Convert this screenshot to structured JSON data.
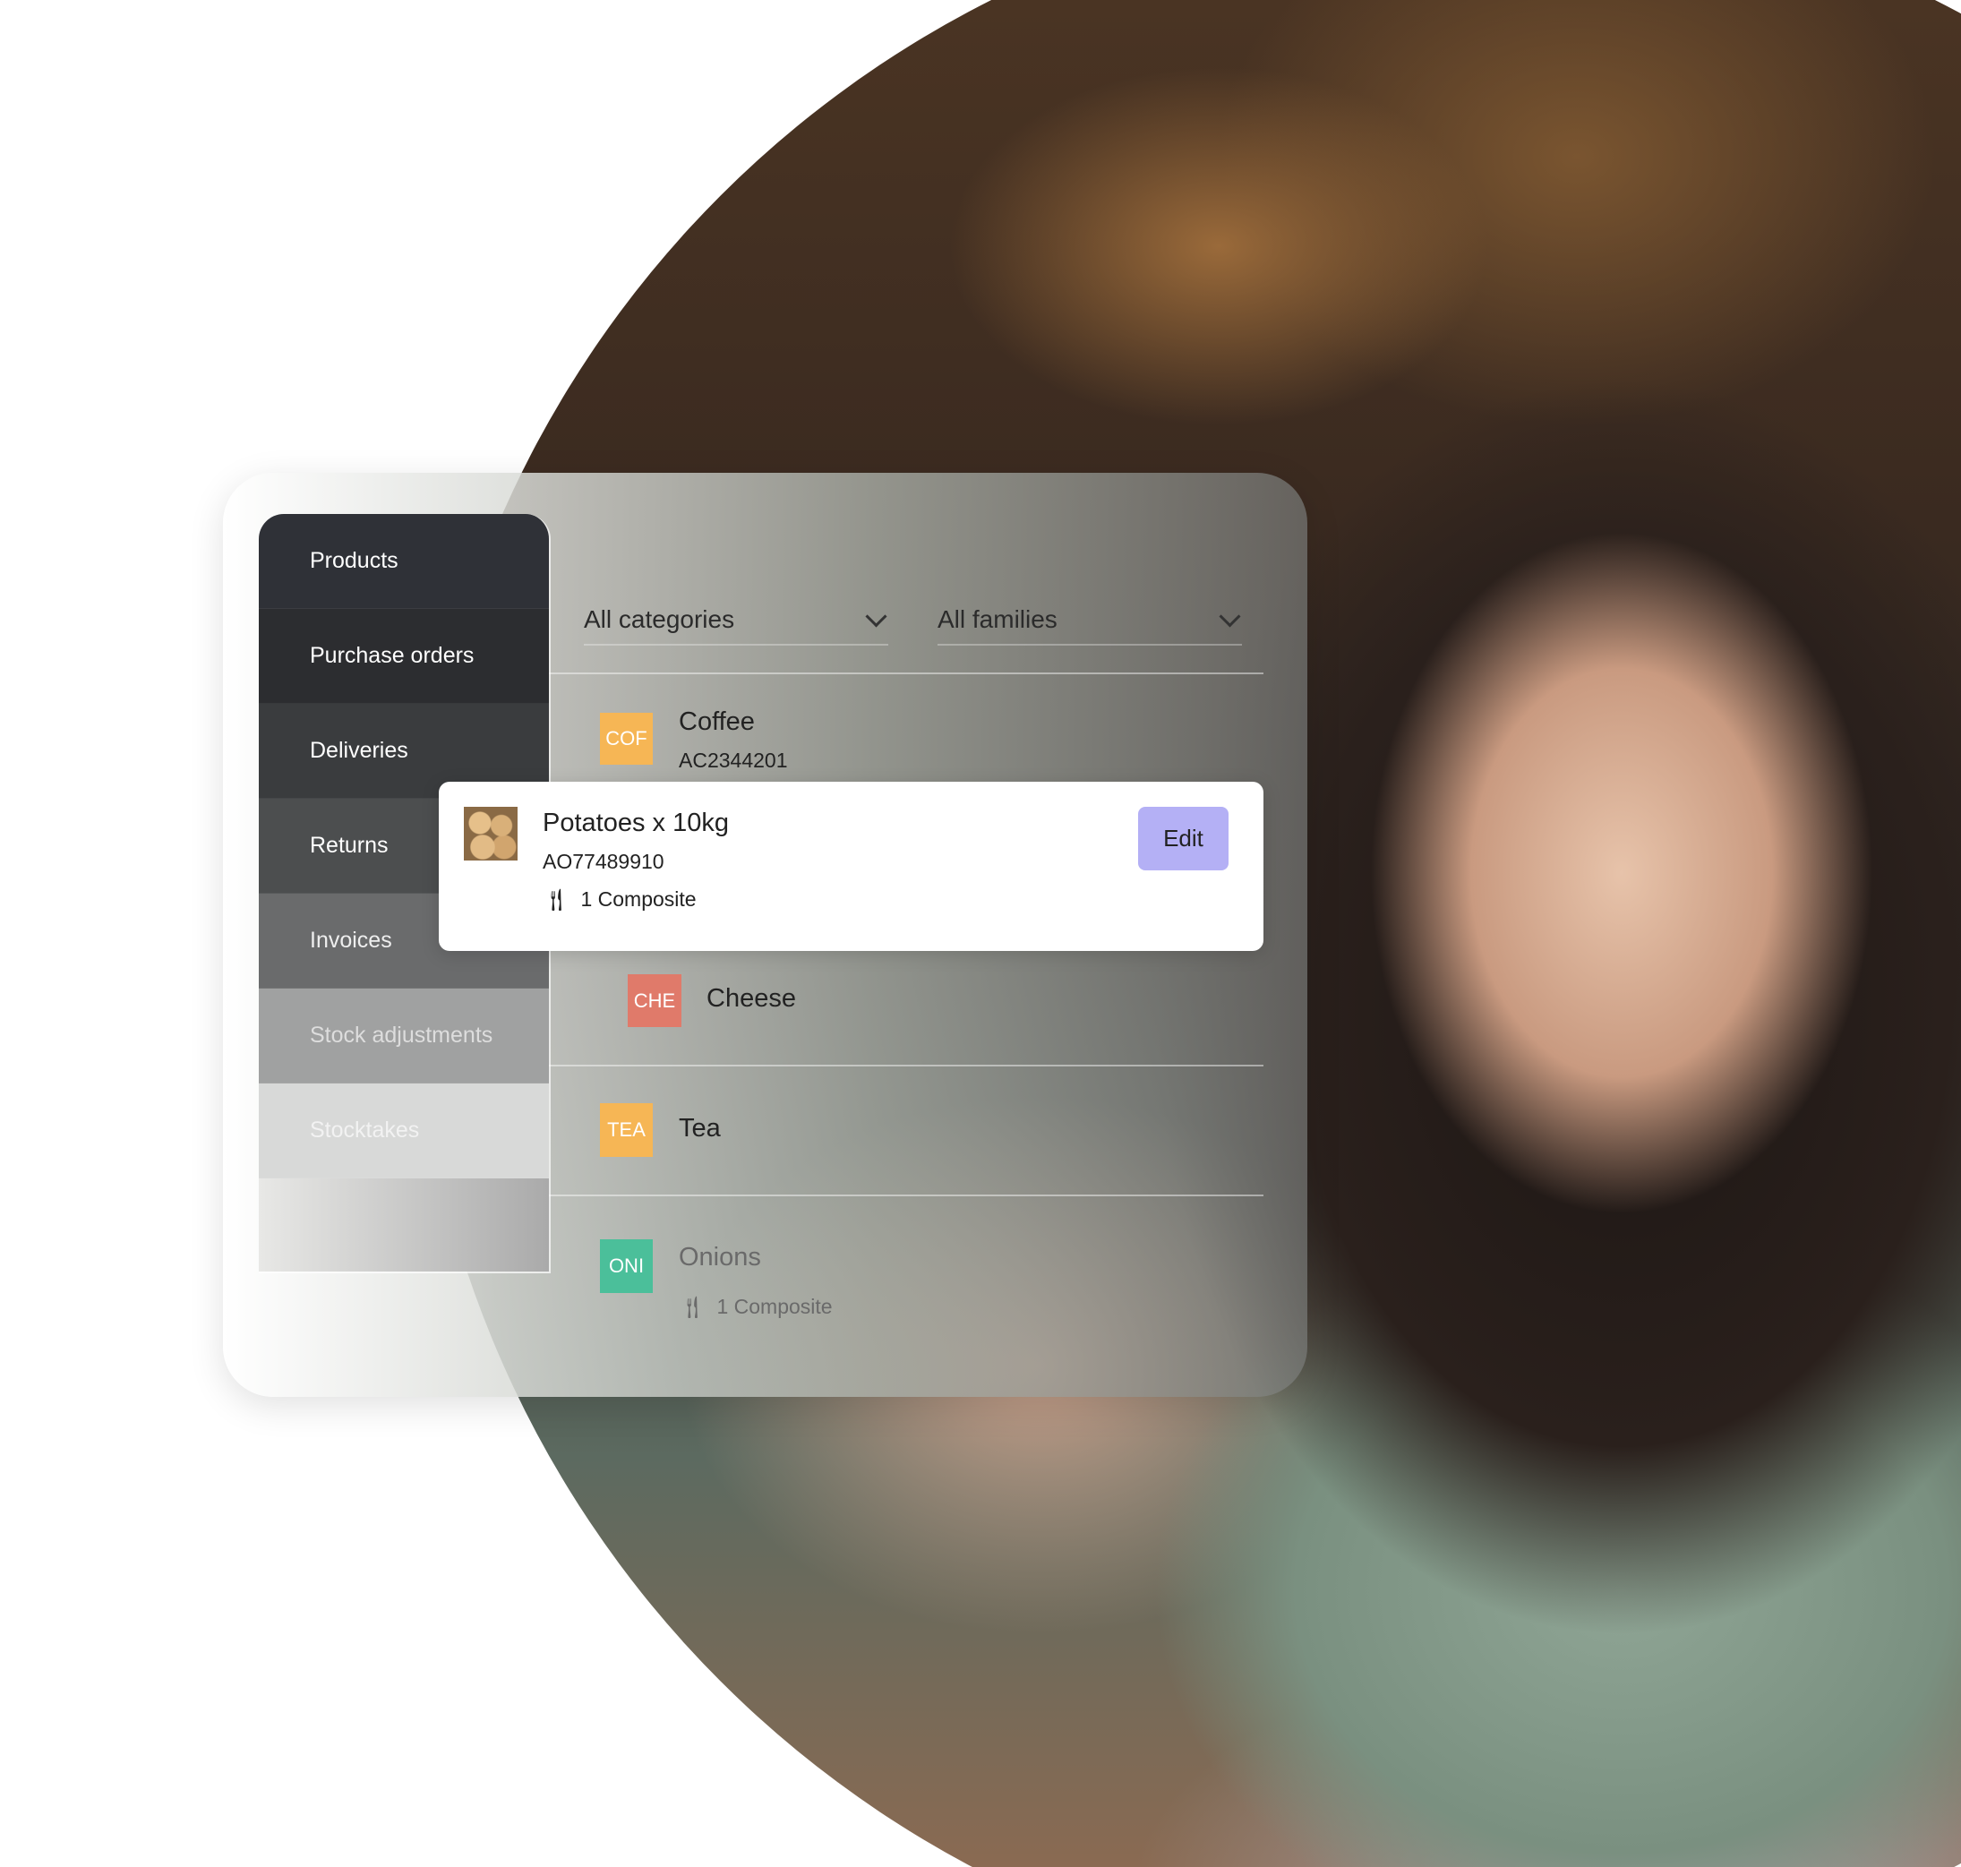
{
  "sidebar": {
    "items": [
      {
        "label": "Products"
      },
      {
        "label": "Purchase orders"
      },
      {
        "label": "Deliveries"
      },
      {
        "label": "Returns"
      },
      {
        "label": "Invoices"
      },
      {
        "label": "Stock adjustments"
      },
      {
        "label": "Stocktakes"
      }
    ]
  },
  "filters": {
    "category": "All categories",
    "family": "All families"
  },
  "products": [
    {
      "badge": "COF",
      "name": "Coffee",
      "code": "AC2344201",
      "color": "#f6b655"
    },
    {
      "name": "Potatoes x 10kg",
      "code": "AO77489910",
      "composite": "1 Composite",
      "edit_label": "Edit",
      "edit_color": "#b4b0f5"
    },
    {
      "badge": "CHE",
      "name": "Cheese",
      "color": "#e07a6a"
    },
    {
      "badge": "TEA",
      "name": "Tea",
      "color": "#f6b655"
    },
    {
      "badge": "ONI",
      "name": "Onions",
      "composite": "1 Composite",
      "color": "#4bbf9a"
    }
  ],
  "icons": {
    "composite": "fork-knife-icon",
    "dropdown": "chevron-down-icon"
  }
}
